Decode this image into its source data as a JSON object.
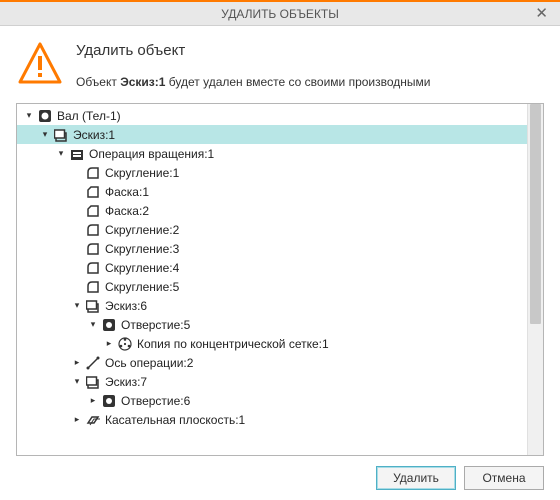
{
  "title": "УДАЛИТЬ ОБЪЕКТЫ",
  "heading": "Удалить объект",
  "subtitle": {
    "prefix": "Объект ",
    "object_name": "Эскиз:1",
    "suffix": " будет удален вместе со своими производными"
  },
  "buttons": {
    "delete": "Удалить",
    "cancel": "Отмена"
  },
  "colors": {
    "accent": "#ff7a00",
    "selection": "#b8e6e6"
  },
  "tree": [
    {
      "indent": 0,
      "exp": "down",
      "icon": "body",
      "label": "Вал (Тел-1)",
      "selected": false
    },
    {
      "indent": 1,
      "exp": "down",
      "icon": "sketch",
      "label": "Эскиз:1",
      "selected": true
    },
    {
      "indent": 2,
      "exp": "down",
      "icon": "revolve",
      "label": "Операция вращения:1",
      "selected": false
    },
    {
      "indent": 3,
      "exp": "none",
      "icon": "fillet",
      "label": "Скругление:1",
      "selected": false
    },
    {
      "indent": 3,
      "exp": "none",
      "icon": "chamfer",
      "label": "Фаска:1",
      "selected": false
    },
    {
      "indent": 3,
      "exp": "none",
      "icon": "chamfer",
      "label": "Фаска:2",
      "selected": false
    },
    {
      "indent": 3,
      "exp": "none",
      "icon": "fillet",
      "label": "Скругление:2",
      "selected": false
    },
    {
      "indent": 3,
      "exp": "none",
      "icon": "fillet",
      "label": "Скругление:3",
      "selected": false
    },
    {
      "indent": 3,
      "exp": "none",
      "icon": "fillet",
      "label": "Скругление:4",
      "selected": false
    },
    {
      "indent": 3,
      "exp": "none",
      "icon": "fillet",
      "label": "Скругление:5",
      "selected": false
    },
    {
      "indent": 3,
      "exp": "down",
      "icon": "sketch",
      "label": "Эскиз:6",
      "selected": false
    },
    {
      "indent": 4,
      "exp": "down",
      "icon": "hole",
      "label": "Отверстие:5",
      "selected": false
    },
    {
      "indent": 5,
      "exp": "right",
      "icon": "pattern",
      "label": "Копия по концентрической сетке:1",
      "selected": false
    },
    {
      "indent": 3,
      "exp": "right",
      "icon": "axis",
      "label": "Ось операции:2",
      "selected": false
    },
    {
      "indent": 3,
      "exp": "down",
      "icon": "sketch",
      "label": "Эскиз:7",
      "selected": false
    },
    {
      "indent": 4,
      "exp": "right",
      "icon": "hole",
      "label": "Отверстие:6",
      "selected": false
    },
    {
      "indent": 3,
      "exp": "right",
      "icon": "plane",
      "label": "Касательная плоскость:1",
      "selected": false
    }
  ],
  "icons": {
    "body": "body-icon",
    "sketch": "sketch-icon",
    "revolve": "revolve-icon",
    "fillet": "fillet-icon",
    "chamfer": "chamfer-icon",
    "hole": "hole-icon",
    "pattern": "pattern-icon",
    "axis": "axis-icon",
    "plane": "plane-icon"
  }
}
